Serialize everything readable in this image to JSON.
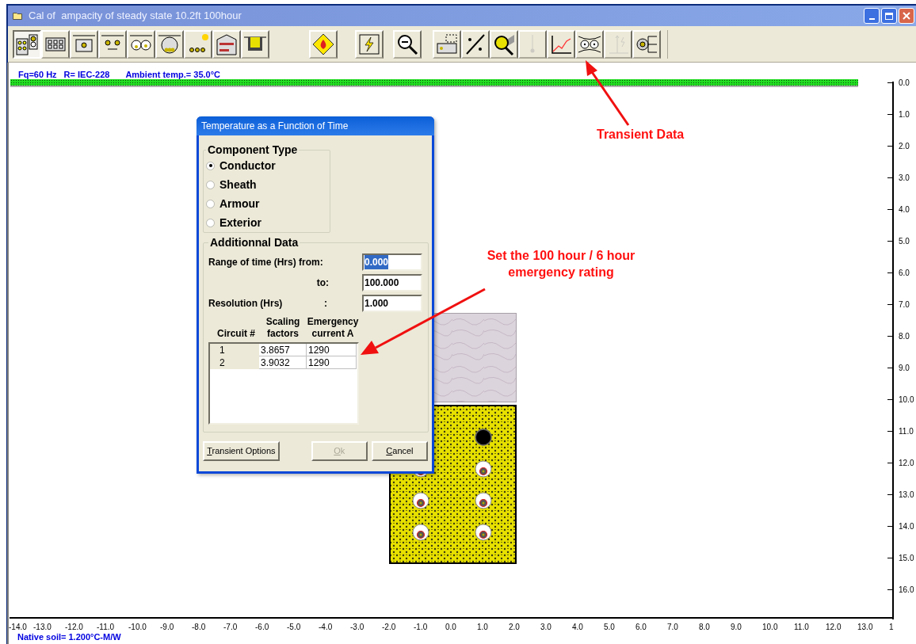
{
  "window": {
    "title": "Cal of  ampacity of steady state 10.2ft 100hour"
  },
  "toolbar": [
    {
      "kind": "duct-bank",
      "selected": true,
      "disabled": false
    },
    {
      "kind": "cable-grid",
      "selected": false,
      "disabled": false
    },
    {
      "kind": "buried-cable",
      "selected": false,
      "disabled": false
    },
    {
      "kind": "spaced-cables",
      "selected": false,
      "disabled": false
    },
    {
      "kind": "two-pipes",
      "selected": false,
      "disabled": false
    },
    {
      "kind": "pipe-triplex",
      "selected": false,
      "disabled": false
    },
    {
      "kind": "sun-cables",
      "selected": false,
      "disabled": false
    },
    {
      "kind": "tunnel",
      "selected": false,
      "disabled": false
    },
    {
      "kind": "trough",
      "selected": false,
      "disabled": false
    },
    {
      "kind": "fire",
      "selected": false,
      "disabled": false
    },
    {
      "kind": "lightning",
      "selected": false,
      "disabled": false
    },
    {
      "kind": "zoom-out",
      "selected": false,
      "disabled": false
    },
    {
      "kind": "coordinates",
      "selected": false,
      "disabled": false
    },
    {
      "kind": "xy-lt",
      "selected": false,
      "disabled": false
    },
    {
      "kind": "magnifier",
      "selected": false,
      "disabled": false
    },
    {
      "kind": "thermometer",
      "selected": false,
      "disabled": true
    },
    {
      "kind": "chart",
      "selected": false,
      "disabled": false
    },
    {
      "kind": "field-lines",
      "selected": false,
      "disabled": false
    },
    {
      "kind": "surge",
      "selected": false,
      "disabled": true
    },
    {
      "kind": "outputs",
      "selected": false,
      "disabled": false
    }
  ],
  "status": [
    "Fq=60 Hz",
    "R= IEC-228",
    "Ambient temp.= 35.0°C"
  ],
  "y_axis": [
    "0.0",
    "1.0",
    "2.0",
    "3.0",
    "4.0",
    "5.0",
    "6.0",
    "7.0",
    "8.0",
    "9.0",
    "10.0",
    "11.0",
    "12.0",
    "13.0",
    "14.0",
    "15.0",
    "16.0"
  ],
  "x_axis": [
    "-14.0",
    "-13.0",
    "-12.0",
    "-11.0",
    "-10.0",
    "-9.0",
    "-8.0",
    "-7.0",
    "-6.0",
    "-5.0",
    "-4.0",
    "-3.0",
    "-2.0",
    "-1.0",
    "0.0",
    "1.0",
    "2.0",
    "3.0",
    "4.0",
    "5.0",
    "6.0",
    "7.0",
    "8.0",
    "9.0",
    "10.0",
    "11.0",
    "12.0",
    "13.0",
    "1"
  ],
  "native_soil": "Native soil= 1.200°C-M/W",
  "dialog": {
    "title": "Temperature as a Function of Time",
    "component_type": {
      "legend": "Component Type",
      "options": [
        {
          "label": "Conductor",
          "selected": true
        },
        {
          "label": "Sheath",
          "selected": false
        },
        {
          "label": "Armour",
          "selected": false
        },
        {
          "label": "Exterior",
          "selected": false
        }
      ]
    },
    "additional": {
      "legend": "Additionnal Data",
      "range_label": "Range of time (Hrs) from:",
      "range_from": {
        "value": "0.000",
        "focused": true
      },
      "to_label": "to:",
      "range_to": {
        "value": "100.000",
        "focused": false
      },
      "resolution_label": "Resolution (Hrs)",
      "resolution_colon": ":",
      "resolution": {
        "value": "1.000",
        "focused": false
      },
      "columns": [
        "Circuit #",
        "Scaling factors",
        "Emergency current A"
      ],
      "rows": [
        [
          "1",
          "3.8657",
          "1290"
        ],
        [
          "2",
          "3.9032",
          "1290"
        ]
      ]
    },
    "buttons": [
      {
        "label": "Transient Options",
        "disabled": false
      },
      {
        "label": "Ok",
        "disabled": true
      },
      {
        "label": "Cancel",
        "disabled": false
      }
    ]
  },
  "annotations": [
    {
      "lines": [
        "Transient Data"
      ]
    },
    {
      "lines": [
        "Set the 100 hour / 6 hour",
        "emergency rating"
      ]
    }
  ]
}
